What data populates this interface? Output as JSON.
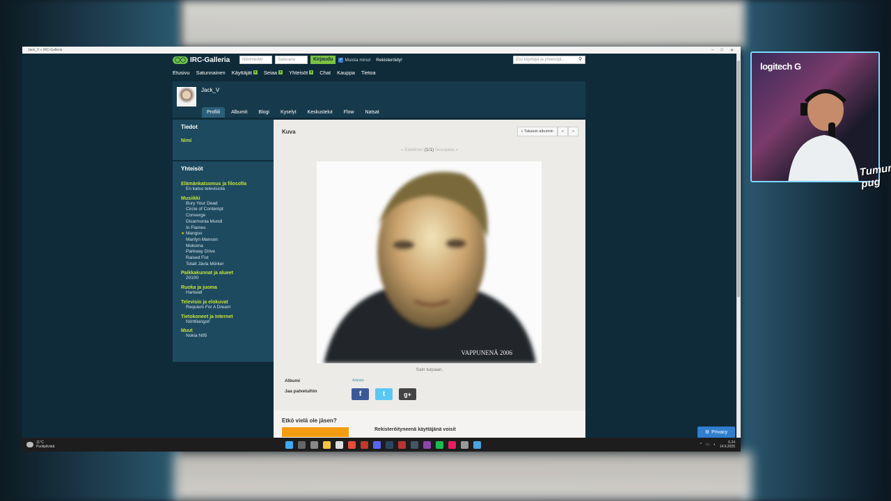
{
  "browser": {
    "tab_title": "Jack_V » IRC-Galleria",
    "controls": [
      "–",
      "□",
      "✕"
    ]
  },
  "site": {
    "logo": "IRC-Galleria",
    "username_placeholder": "Nimimerkki",
    "password_placeholder": "Salasana",
    "login_label": "Kirjaudu",
    "remember_label": "Muista minut",
    "register_label": "Rekisteröidy!",
    "search_placeholder": "Etsi käyttäjiä ja yhteisöjä...",
    "nav": [
      "Etusivu",
      "Satunnainen",
      "Käyttäjät",
      "Seiaa",
      "Yhteisöt",
      "Chat",
      "Kauppa",
      "Tietoa"
    ]
  },
  "profile": {
    "username": "Jack_V",
    "tabs": [
      "Profiili",
      "Albumit",
      "Blogi",
      "Kyselyt",
      "Keskustelut",
      "Flow",
      "Natsat"
    ]
  },
  "sidebar": {
    "tiedot_title": "Tiedot",
    "nimi_label": "Nimi",
    "yhteisot_title": "Yhteisöt",
    "groups": [
      {
        "label": "Elämänkatsomus ja filosofia",
        "items": [
          "En katso televisiota"
        ]
      },
      {
        "label": "Musiikki",
        "items": [
          "Bury Your Dead",
          "Circle of Contempt",
          "Converge",
          "Disarmonia Mundi",
          "In Flames",
          "Mangoo",
          "Marilyn Manson",
          "Mokoma",
          "Parkway Drive",
          "Raised Fist",
          "Totalt Jävla Mörker"
        ]
      },
      {
        "label": "Paikkakunnat ja alueet",
        "items": [
          "20100"
        ]
      },
      {
        "label": "Ruoka ja juoma",
        "items": [
          "Hartwall"
        ]
      },
      {
        "label": "Televisio ja elokuvat",
        "items": [
          "Requiem For A Dream"
        ]
      },
      {
        "label": "Tietokoneet ja Internet",
        "items": [
          "Nörttilangst!"
        ]
      },
      {
        "label": "Muut",
        "items": [
          "Nokia N95"
        ]
      }
    ],
    "starred_item": "Mangoo"
  },
  "photo_view": {
    "heading": "Kuva",
    "back_to_album": "« Takaisin albumiin",
    "prev_icon": "«",
    "next_icon": "»",
    "pager_prev": "« Edellinen",
    "pager_pos": "(1/1)",
    "pager_next": "Seuraava »",
    "watermark": "VAPPUNENÄ 2006",
    "caption": "Sain turpaan.",
    "album_label": "Albumi",
    "album_value": "Arkisto",
    "share_label": "Jaa palveluihin"
  },
  "join": {
    "title": "Etkö vielä ole jäsen?",
    "desc": "Rekisteröityneenä käyttäjänä voisit"
  },
  "privacy_label": "Privacy",
  "taskbar": {
    "temp": "11°C",
    "weather": "Puolipilvistä",
    "time": "6.24",
    "date": "14.6.2025"
  },
  "cam": {
    "logo": "logitech G",
    "signature": "Tumun pug"
  }
}
